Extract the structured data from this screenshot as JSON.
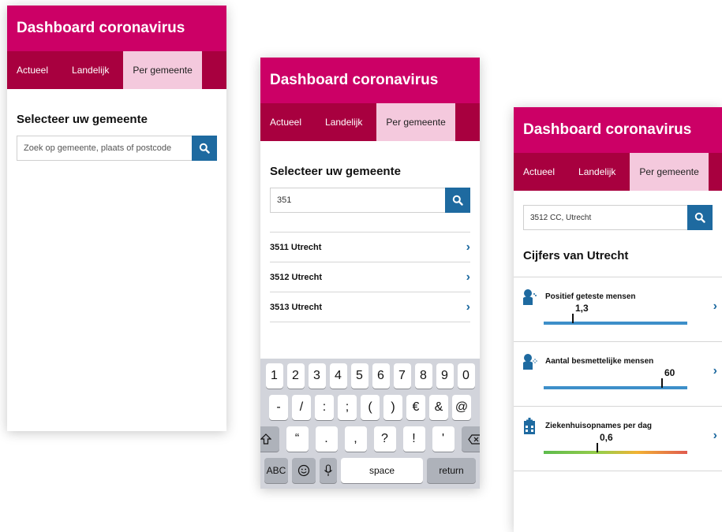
{
  "app": {
    "title": "Dashboard coronavirus"
  },
  "tabs": [
    "Actueel",
    "Landelijk",
    "Per gemeente"
  ],
  "screen1": {
    "heading": "Selecteer uw gemeente",
    "search_placeholder": "Zoek op gemeente, plaats of postcode"
  },
  "screen2": {
    "heading": "Selecteer uw gemeente",
    "search_value": "351",
    "results": [
      "3511 Utrecht",
      "3512 Utrecht",
      "3513 Utrecht"
    ],
    "keyboard": {
      "row1": [
        "1",
        "2",
        "3",
        "4",
        "5",
        "6",
        "7",
        "8",
        "9",
        "0"
      ],
      "row2": [
        "-",
        "/",
        ":",
        ";",
        "(",
        ")",
        "€",
        "&",
        "@"
      ],
      "row3": [
        ".",
        ",",
        "?",
        "!",
        "'"
      ],
      "abc": "ABC",
      "space": "space",
      "return": "return"
    }
  },
  "screen3": {
    "search_value": "3512 CC, Utrecht",
    "heading": "Cijfers van Utrecht",
    "metrics": [
      {
        "label": "Positief geteste mensen",
        "value": "1,3",
        "fraction": 0.2,
        "bar_color": "#3d8fc9",
        "icon": "person-coughing-icon"
      },
      {
        "label": "Aantal besmettelijke mensen",
        "value": "60",
        "fraction": 0.82,
        "bar_color": "#3d8fc9",
        "icon": "person-sneezing-icon"
      },
      {
        "label": "Ziekenhuisopnames per dag",
        "value": "0,6",
        "fraction": 0.37,
        "bar_color": "gradient",
        "icon": "hospital-icon"
      }
    ]
  },
  "colors": {
    "header": "#cc0066",
    "tabs": "#a8003f",
    "active_tab": "#f4c9dd",
    "accent": "#1e6aa0"
  }
}
